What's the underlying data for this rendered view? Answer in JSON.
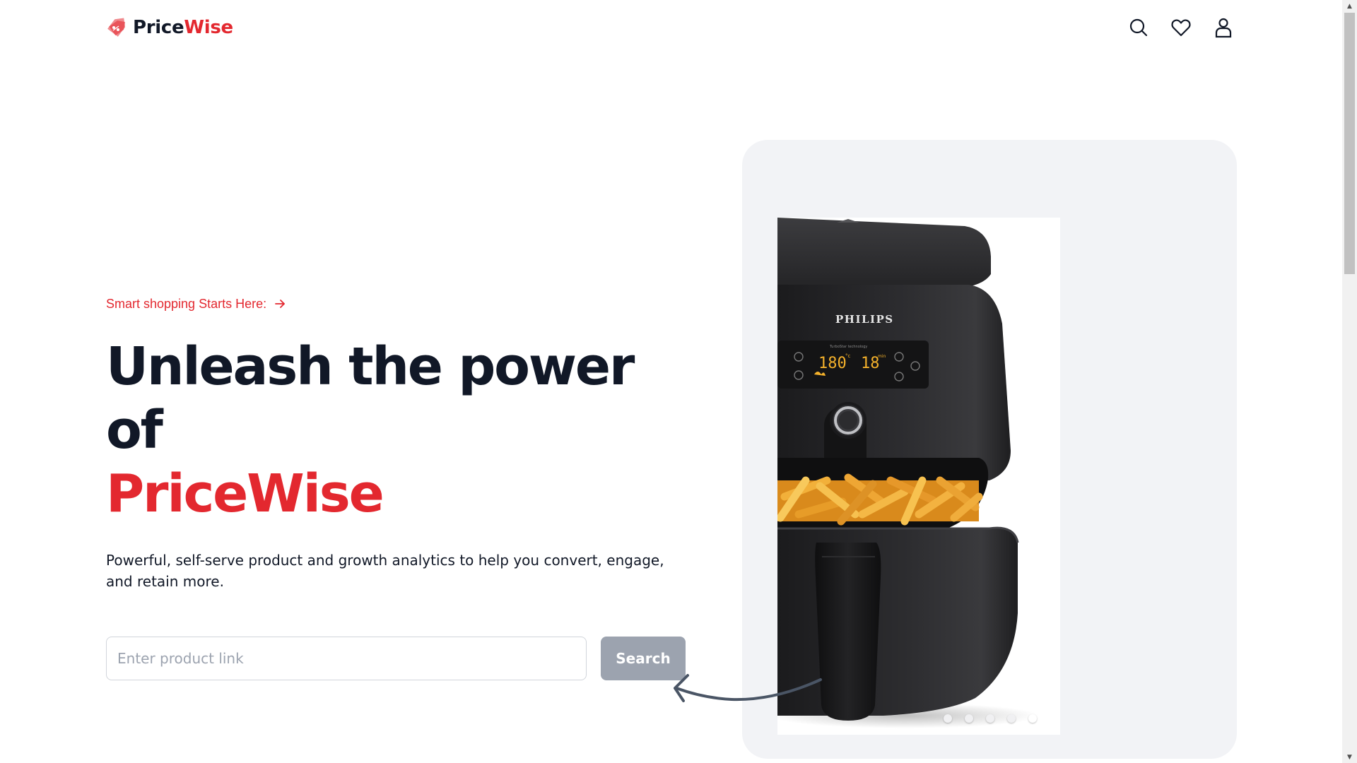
{
  "brand": {
    "name_part1": "Price",
    "name_part2": "Wise",
    "logo_icon": "price-tag-icon",
    "colors": {
      "accent": "#e3282f",
      "text": "#111827"
    }
  },
  "nav": {
    "icons": [
      "search-icon",
      "heart-icon",
      "user-icon"
    ]
  },
  "hero": {
    "tagline": "Smart shopping Starts Here:",
    "headline_line1": "Unleash the power of",
    "headline_accent": "PriceWise",
    "subtext": "Powerful, self-serve product and growth analytics to help you convert, engage, and retain more."
  },
  "search": {
    "placeholder": "Enter product link",
    "value": "",
    "button_label": "Search",
    "button_color": "#9ca3af"
  },
  "product_image": {
    "brand_label": "PHILIPS",
    "display_temp": "180",
    "display_time": "18",
    "temp_unit": "°c",
    "time_unit": "min",
    "display_caption": "TurboStar technology"
  },
  "carousel": {
    "slide_count": 5,
    "active_index": 4,
    "background": "#f2f3f6"
  }
}
